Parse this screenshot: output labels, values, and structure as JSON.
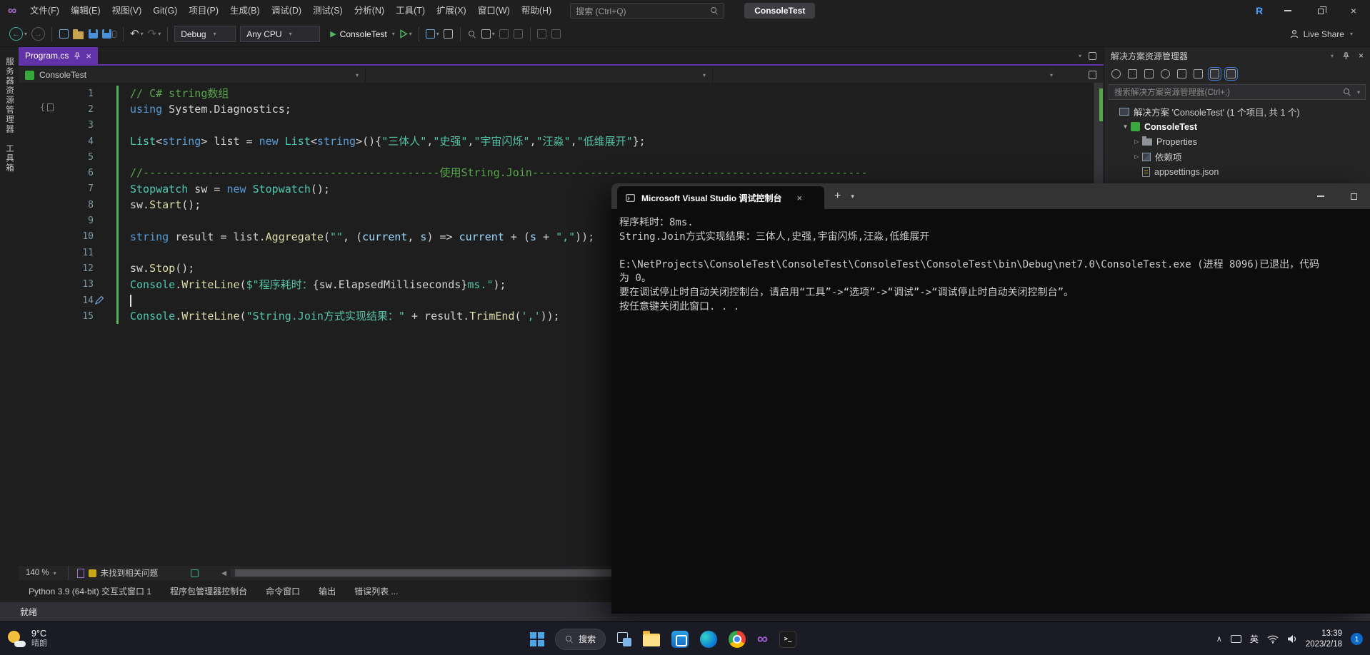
{
  "glyphs": {
    "vs_logo": "∞",
    "chevron_down": "▾",
    "chevron_right": "▸",
    "chevron_up": "∧",
    "close": "×",
    "plus": "+",
    "back_arrow": "←",
    "forward_arrow": "→",
    "undo": "↶",
    "redo": "↷",
    "play": "▶",
    "scroll_left": "◀",
    "expanded": "▼",
    "collapsed": "▷",
    "terminal_prompt": "&gt;_"
  },
  "title_bar": {
    "menus": [
      "文件(F)",
      "编辑(E)",
      "视图(V)",
      "Git(G)",
      "项目(P)",
      "生成(B)",
      "调试(D)",
      "测试(S)",
      "分析(N)",
      "工具(T)",
      "扩展(X)",
      "窗口(W)",
      "帮助(H)"
    ],
    "search_placeholder": "搜索 (Ctrl+Q)",
    "solution_name": "ConsoleTest",
    "account_initial": "R"
  },
  "toolbar": {
    "configuration": "Debug",
    "platform": "Any CPU",
    "start_label": "ConsoleTest",
    "live_share_label": "Live Share"
  },
  "left_rail": [
    "服务器资源管理器",
    "工具箱"
  ],
  "editor": {
    "tab_label": "Program.cs",
    "breadcrumb_project": "ConsoleTest",
    "gutter_brace": "{",
    "zoom_level": "140 %",
    "health_status": "未找到相关问题",
    "lines": [
      {
        "n": "1",
        "tokens": [
          [
            "com",
            "// C# string数组"
          ]
        ]
      },
      {
        "n": "2",
        "tokens": [
          [
            "kw",
            "using"
          ],
          [
            "pl",
            " System.Diagnostics;"
          ]
        ]
      },
      {
        "n": "3",
        "tokens": []
      },
      {
        "n": "4",
        "tokens": [
          [
            "ty",
            "List"
          ],
          [
            "pl",
            "<"
          ],
          [
            "kw",
            "string"
          ],
          [
            "pl",
            "> list = "
          ],
          [
            "kw",
            "new"
          ],
          [
            "pl",
            " "
          ],
          [
            "ty",
            "List"
          ],
          [
            "pl",
            "<"
          ],
          [
            "kw",
            "string"
          ],
          [
            "pl",
            ">(){"
          ],
          [
            "st",
            "\"三体人\""
          ],
          [
            "pl",
            ","
          ],
          [
            "st",
            "\"史强\""
          ],
          [
            "pl",
            ","
          ],
          [
            "st",
            "\"宇宙闪烁\""
          ],
          [
            "pl",
            ","
          ],
          [
            "st",
            "\"汪淼\""
          ],
          [
            "pl",
            ","
          ],
          [
            "st",
            "\"低维展开\""
          ],
          [
            "pl",
            "};"
          ]
        ]
      },
      {
        "n": "5",
        "tokens": []
      },
      {
        "n": "6",
        "tokens": [
          [
            "com",
            "//----------------------------------------------使用String.Join----------------------------------------------------"
          ]
        ]
      },
      {
        "n": "7",
        "tokens": [
          [
            "ty",
            "Stopwatch"
          ],
          [
            "pl",
            " sw = "
          ],
          [
            "kw",
            "new"
          ],
          [
            "pl",
            " "
          ],
          [
            "ty",
            "Stopwatch"
          ],
          [
            "pl",
            "();"
          ]
        ]
      },
      {
        "n": "8",
        "tokens": [
          [
            "pl",
            "sw."
          ],
          [
            "me",
            "Start"
          ],
          [
            "pl",
            "();"
          ]
        ]
      },
      {
        "n": "9",
        "tokens": []
      },
      {
        "n": "10",
        "tokens": [
          [
            "kw",
            "string"
          ],
          [
            "pl",
            " result = list."
          ],
          [
            "me",
            "Aggregate"
          ],
          [
            "pl",
            "("
          ],
          [
            "st",
            "\"\""
          ],
          [
            "pl",
            ", ("
          ],
          [
            "pm",
            "current"
          ],
          [
            "pl",
            ", "
          ],
          [
            "pm",
            "s"
          ],
          [
            "pl",
            ") => "
          ],
          [
            "pm",
            "current"
          ],
          [
            "pl",
            " + ("
          ],
          [
            "pm",
            "s"
          ],
          [
            "pl",
            " + "
          ],
          [
            "st",
            "\",\""
          ],
          [
            "pl",
            "));"
          ]
        ]
      },
      {
        "n": "11",
        "tokens": []
      },
      {
        "n": "12",
        "tokens": [
          [
            "pl",
            "sw."
          ],
          [
            "me",
            "Stop"
          ],
          [
            "pl",
            "();"
          ]
        ]
      },
      {
        "n": "13",
        "tokens": [
          [
            "ty",
            "Console"
          ],
          [
            "pl",
            "."
          ],
          [
            "me",
            "WriteLine"
          ],
          [
            "pl",
            "("
          ],
          [
            "st",
            "$\"程序耗时："
          ],
          [
            "ip",
            "{sw.ElapsedMilliseconds}"
          ],
          [
            "st",
            "ms.\""
          ],
          [
            "pl",
            ");"
          ]
        ]
      },
      {
        "n": "14",
        "tokens": [],
        "cursor": true,
        "pen": true
      },
      {
        "n": "15",
        "tokens": [
          [
            "ty",
            "Console"
          ],
          [
            "pl",
            "."
          ],
          [
            "me",
            "WriteLine"
          ],
          [
            "pl",
            "("
          ],
          [
            "st",
            "\"String.Join方式实现结果：\""
          ],
          [
            "pl",
            " + result."
          ],
          [
            "me",
            "TrimEnd"
          ],
          [
            "pl",
            "("
          ],
          [
            "st",
            "','"
          ],
          [
            "pl",
            "));"
          ]
        ]
      }
    ]
  },
  "solution_explorer": {
    "title": "解决方案资源管理器",
    "search_placeholder": "搜索解决方案资源管理器(Ctrl+;)",
    "tree": [
      {
        "label": "解决方案 'ConsoleTest' (1 个项目, 共 1 个)",
        "icon": "solution",
        "indent": 0
      },
      {
        "label": "ConsoleTest",
        "icon": "csproj",
        "indent": 1,
        "arrow": "expanded",
        "bold": true
      },
      {
        "label": "Properties",
        "icon": "properties",
        "indent": 2,
        "arrow": "collapsed"
      },
      {
        "label": "依赖项",
        "icon": "dependencies",
        "indent": 2,
        "arrow": "collapsed"
      },
      {
        "label": "appsettings.json",
        "icon": "json",
        "indent": 2
      }
    ]
  },
  "debug_console": {
    "tab_title": "Microsoft Visual Studio 调试控制台",
    "lines": [
      "程序耗时：8ms.",
      "String.Join方式实现结果：三体人,史强,宇宙闪烁,汪淼,低维展开",
      "",
      "E:\\NetProjects\\ConsoleTest\\ConsoleTest\\ConsoleTest\\ConsoleTest\\bin\\Debug\\net7.0\\ConsoleTest.exe (进程 8096)已退出，代码",
      "为 0。",
      "要在调试停止时自动关闭控制台，请启用“工具”->“选项”->“调试”->“调试停止时自动关闭控制台”。",
      "按任意键关闭此窗口. . ."
    ]
  },
  "panel_tabs": [
    "Python 3.9 (64-bit) 交互式窗口 1",
    "程序包管理器控制台",
    "命令窗口",
    "输出",
    "错误列表 ..."
  ],
  "status_bar": {
    "text": "就绪"
  },
  "taskbar": {
    "weather_temp": "9°C",
    "weather_desc": "晴朗",
    "search_label": "搜索",
    "ime": "英",
    "time": "13:39",
    "date": "2023/2/18",
    "badge_count": "1"
  }
}
